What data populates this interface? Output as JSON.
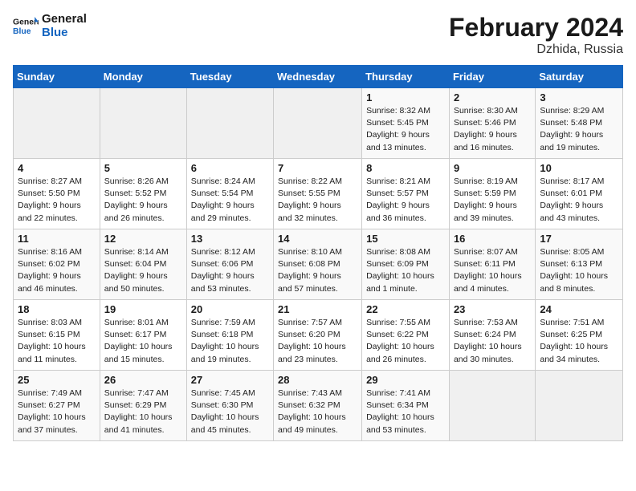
{
  "logo": {
    "line1": "General",
    "line2": "Blue"
  },
  "title": "February 2024",
  "subtitle": "Dzhida, Russia",
  "days_header": [
    "Sunday",
    "Monday",
    "Tuesday",
    "Wednesday",
    "Thursday",
    "Friday",
    "Saturday"
  ],
  "weeks": [
    [
      {
        "num": "",
        "info": ""
      },
      {
        "num": "",
        "info": ""
      },
      {
        "num": "",
        "info": ""
      },
      {
        "num": "",
        "info": ""
      },
      {
        "num": "1",
        "info": "Sunrise: 8:32 AM\nSunset: 5:45 PM\nDaylight: 9 hours\nand 13 minutes."
      },
      {
        "num": "2",
        "info": "Sunrise: 8:30 AM\nSunset: 5:46 PM\nDaylight: 9 hours\nand 16 minutes."
      },
      {
        "num": "3",
        "info": "Sunrise: 8:29 AM\nSunset: 5:48 PM\nDaylight: 9 hours\nand 19 minutes."
      }
    ],
    [
      {
        "num": "4",
        "info": "Sunrise: 8:27 AM\nSunset: 5:50 PM\nDaylight: 9 hours\nand 22 minutes."
      },
      {
        "num": "5",
        "info": "Sunrise: 8:26 AM\nSunset: 5:52 PM\nDaylight: 9 hours\nand 26 minutes."
      },
      {
        "num": "6",
        "info": "Sunrise: 8:24 AM\nSunset: 5:54 PM\nDaylight: 9 hours\nand 29 minutes."
      },
      {
        "num": "7",
        "info": "Sunrise: 8:22 AM\nSunset: 5:55 PM\nDaylight: 9 hours\nand 32 minutes."
      },
      {
        "num": "8",
        "info": "Sunrise: 8:21 AM\nSunset: 5:57 PM\nDaylight: 9 hours\nand 36 minutes."
      },
      {
        "num": "9",
        "info": "Sunrise: 8:19 AM\nSunset: 5:59 PM\nDaylight: 9 hours\nand 39 minutes."
      },
      {
        "num": "10",
        "info": "Sunrise: 8:17 AM\nSunset: 6:01 PM\nDaylight: 9 hours\nand 43 minutes."
      }
    ],
    [
      {
        "num": "11",
        "info": "Sunrise: 8:16 AM\nSunset: 6:02 PM\nDaylight: 9 hours\nand 46 minutes."
      },
      {
        "num": "12",
        "info": "Sunrise: 8:14 AM\nSunset: 6:04 PM\nDaylight: 9 hours\nand 50 minutes."
      },
      {
        "num": "13",
        "info": "Sunrise: 8:12 AM\nSunset: 6:06 PM\nDaylight: 9 hours\nand 53 minutes."
      },
      {
        "num": "14",
        "info": "Sunrise: 8:10 AM\nSunset: 6:08 PM\nDaylight: 9 hours\nand 57 minutes."
      },
      {
        "num": "15",
        "info": "Sunrise: 8:08 AM\nSunset: 6:09 PM\nDaylight: 10 hours\nand 1 minute."
      },
      {
        "num": "16",
        "info": "Sunrise: 8:07 AM\nSunset: 6:11 PM\nDaylight: 10 hours\nand 4 minutes."
      },
      {
        "num": "17",
        "info": "Sunrise: 8:05 AM\nSunset: 6:13 PM\nDaylight: 10 hours\nand 8 minutes."
      }
    ],
    [
      {
        "num": "18",
        "info": "Sunrise: 8:03 AM\nSunset: 6:15 PM\nDaylight: 10 hours\nand 11 minutes."
      },
      {
        "num": "19",
        "info": "Sunrise: 8:01 AM\nSunset: 6:17 PM\nDaylight: 10 hours\nand 15 minutes."
      },
      {
        "num": "20",
        "info": "Sunrise: 7:59 AM\nSunset: 6:18 PM\nDaylight: 10 hours\nand 19 minutes."
      },
      {
        "num": "21",
        "info": "Sunrise: 7:57 AM\nSunset: 6:20 PM\nDaylight: 10 hours\nand 23 minutes."
      },
      {
        "num": "22",
        "info": "Sunrise: 7:55 AM\nSunset: 6:22 PM\nDaylight: 10 hours\nand 26 minutes."
      },
      {
        "num": "23",
        "info": "Sunrise: 7:53 AM\nSunset: 6:24 PM\nDaylight: 10 hours\nand 30 minutes."
      },
      {
        "num": "24",
        "info": "Sunrise: 7:51 AM\nSunset: 6:25 PM\nDaylight: 10 hours\nand 34 minutes."
      }
    ],
    [
      {
        "num": "25",
        "info": "Sunrise: 7:49 AM\nSunset: 6:27 PM\nDaylight: 10 hours\nand 37 minutes."
      },
      {
        "num": "26",
        "info": "Sunrise: 7:47 AM\nSunset: 6:29 PM\nDaylight: 10 hours\nand 41 minutes."
      },
      {
        "num": "27",
        "info": "Sunrise: 7:45 AM\nSunset: 6:30 PM\nDaylight: 10 hours\nand 45 minutes."
      },
      {
        "num": "28",
        "info": "Sunrise: 7:43 AM\nSunset: 6:32 PM\nDaylight: 10 hours\nand 49 minutes."
      },
      {
        "num": "29",
        "info": "Sunrise: 7:41 AM\nSunset: 6:34 PM\nDaylight: 10 hours\nand 53 minutes."
      },
      {
        "num": "",
        "info": ""
      },
      {
        "num": "",
        "info": ""
      }
    ]
  ]
}
